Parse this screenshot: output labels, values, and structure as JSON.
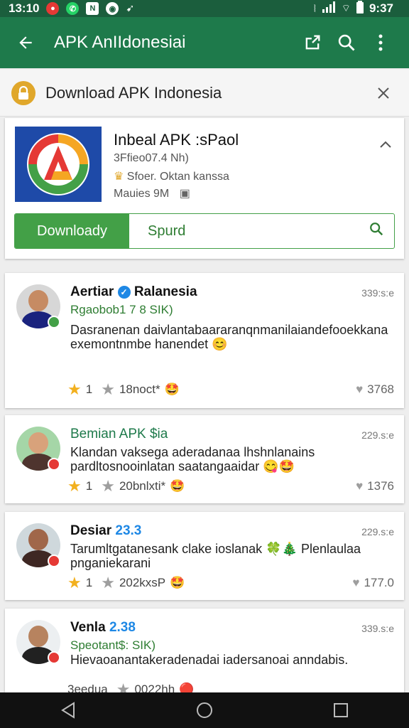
{
  "status_bar": {
    "time": "13:10",
    "right_time": "9:37",
    "icons": [
      "record-icon",
      "whatsapp-icon",
      "notification-icon",
      "media-icon",
      "signal-icon",
      "wifi-icon",
      "battery-icon"
    ]
  },
  "app_bar": {
    "title": "APK AnIIdonesiai",
    "color": "#1e7a4b"
  },
  "banner": {
    "title": "Download APK Indonesia"
  },
  "app_card": {
    "name": "Inbeal APK :sPaol",
    "meta_line1": "3Ffieo07.4  Nh)",
    "meta_line2": "Sfoer. Oktan kanssa",
    "meta_line3": "Mauies 9M",
    "download_label": "Downloady",
    "search_label": "Spurd",
    "accent": "#43a047"
  },
  "reviews": [
    {
      "name": "Aertiar",
      "name_tag": "Ralanesia",
      "sub": "Rgaobob1 7 8  SIK)",
      "time": "339:s:e",
      "text": "Dasranenan daivlantabaararanqnmanilaiandefooekkana exemontnmbe hanendet 😊",
      "rating": "1",
      "rating_sub": "18noct*",
      "likes": "3768"
    },
    {
      "name": "Bemian APK $ia",
      "name_tag": "",
      "sub": "",
      "time": "229.s:e",
      "text": "Klandan vaksega aderadanaa lhshnlanains pardltosnooinlatan saatangaaidar 😋🤩",
      "rating": "1",
      "rating_sub": "20bnlxti*",
      "likes": "1376"
    },
    {
      "name": "Desiar",
      "name_tag": "23.3",
      "sub": "",
      "time": "229.s:e",
      "text": "Tarumltgatanesank clake ioslanak 🍀🎄 Plenlaulaa pnganiekarani",
      "rating": "1",
      "rating_sub": "202kxsP",
      "likes": "177.0"
    },
    {
      "name": "Venla",
      "name_tag": "2.38",
      "sub": "Speotant$: SIK)",
      "time": "339.s:e",
      "text": "Hievaoanantakeradenadai iadersanoai anndabis.",
      "rating": "3eedua",
      "rating_sub": "0022hh",
      "likes": ""
    }
  ]
}
